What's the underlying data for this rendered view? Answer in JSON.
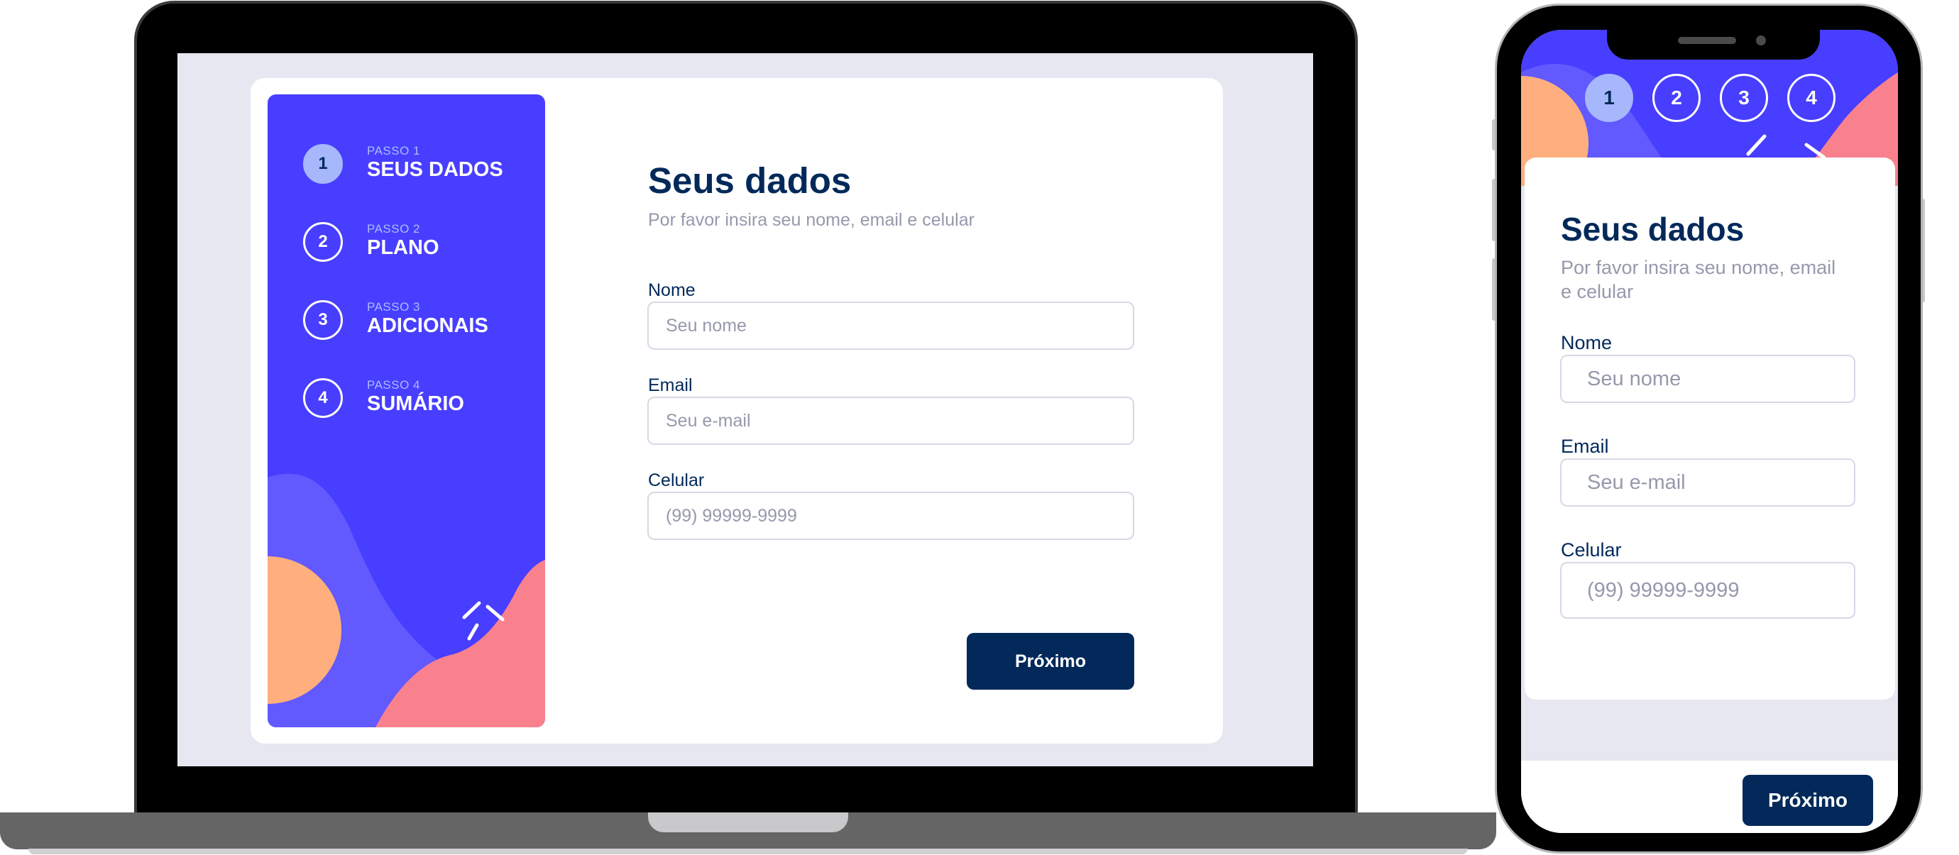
{
  "colors": {
    "sidebar_bg": "#483eff",
    "accent_orange": "#ffaf7e",
    "accent_pink": "#f9818e",
    "accent_light_purple": "#6259ff",
    "active_step": "#bfe2fd",
    "primary_text": "#02295a",
    "muted_text": "#9699ab",
    "button_bg": "#02295a",
    "page_bg": "#e6e7f1"
  },
  "desktop": {
    "steps": [
      {
        "number": "1",
        "small": "PASSO 1",
        "title": "SEUS DADOS",
        "active": true
      },
      {
        "number": "2",
        "small": "PASSO 2",
        "title": "PLANO",
        "active": false
      },
      {
        "number": "3",
        "small": "PASSO 3",
        "title": "ADICIONAIS",
        "active": false
      },
      {
        "number": "4",
        "small": "PASSO 4",
        "title": "SUMÁRIO",
        "active": false
      }
    ],
    "form": {
      "title": "Seus dados",
      "subtitle": "Por favor insira seu nome, email e celular",
      "fields": [
        {
          "label": "Nome",
          "placeholder": "Seu nome",
          "value": ""
        },
        {
          "label": "Email",
          "placeholder": "Seu e-mail",
          "value": ""
        },
        {
          "label": "Celular",
          "placeholder": "(99) 99999-9999",
          "value": ""
        }
      ],
      "next_button": "Próximo"
    }
  },
  "mobile": {
    "steps": [
      "1",
      "2",
      "3",
      "4"
    ],
    "active_step": "1",
    "form": {
      "title": "Seus dados",
      "subtitle_line1": "Por favor insira seu nome, email",
      "subtitle_line2": "e celular",
      "fields": [
        {
          "label": "Nome",
          "placeholder": "Seu nome",
          "value": ""
        },
        {
          "label": "Email",
          "placeholder": "Seu e-mail",
          "value": ""
        },
        {
          "label": "Celular",
          "placeholder": "(99) 99999-9999",
          "value": ""
        }
      ],
      "next_button": "Próximo"
    }
  }
}
